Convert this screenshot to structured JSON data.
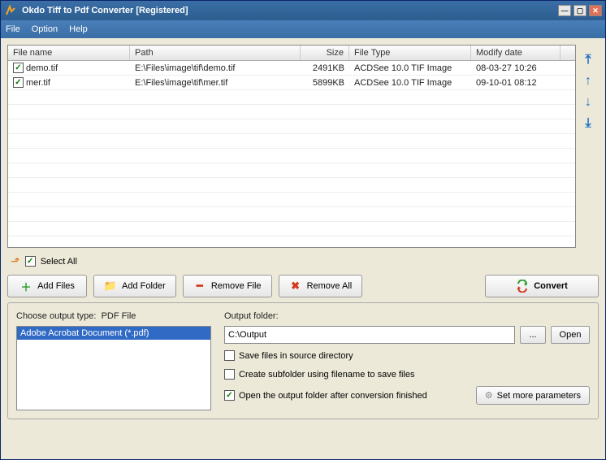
{
  "title": "Okdo Tiff to Pdf Converter [Registered]",
  "menu": {
    "file": "File",
    "option": "Option",
    "help": "Help"
  },
  "columns": {
    "name": "File name",
    "path": "Path",
    "size": "Size",
    "type": "File Type",
    "date": "Modify date"
  },
  "files": [
    {
      "checked": true,
      "name": "demo.tif",
      "path": "E:\\Files\\image\\tif\\demo.tif",
      "size": "2491KB",
      "type": "ACDSee 10.0 TIF Image",
      "date": "08-03-27 10:26"
    },
    {
      "checked": true,
      "name": "mer.tif",
      "path": "E:\\Files\\image\\tif\\mer.tif",
      "size": "5899KB",
      "type": "ACDSee 10.0 TIF Image",
      "date": "09-10-01 08:12"
    }
  ],
  "selectall": {
    "checked": true,
    "label": "Select All"
  },
  "buttons": {
    "addfiles": "Add Files",
    "addfolder": "Add Folder",
    "removefile": "Remove File",
    "removeall": "Remove All",
    "convert": "Convert"
  },
  "outtype": {
    "label": "Choose output type:",
    "current": "PDF File",
    "option": "Adobe Acrobat Document (*.pdf)"
  },
  "outfolder": {
    "label": "Output folder:",
    "value": "C:\\Output",
    "browse": "...",
    "open": "Open"
  },
  "opts": {
    "savesrc": {
      "checked": false,
      "label": "Save files in source directory"
    },
    "subfolder": {
      "checked": false,
      "label": "Create subfolder using filename to save files"
    },
    "openafter": {
      "checked": true,
      "label": "Open the output folder after conversion finished"
    }
  },
  "more": "Set more parameters"
}
